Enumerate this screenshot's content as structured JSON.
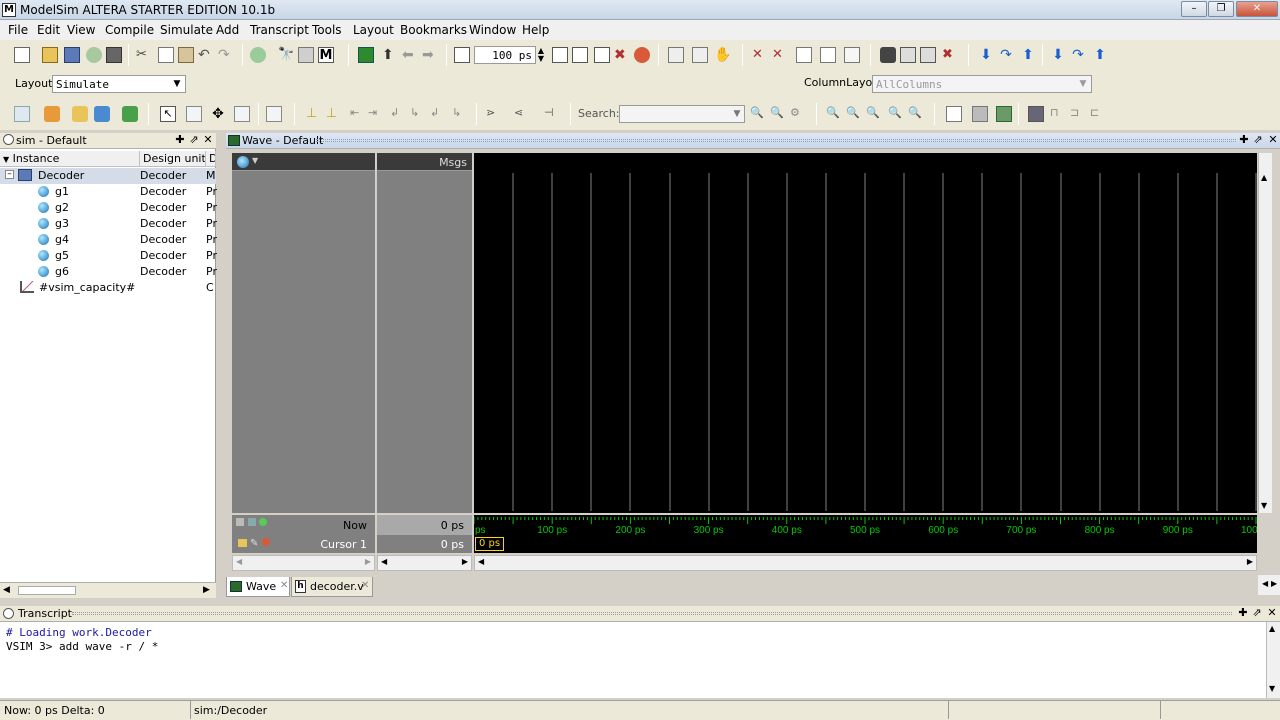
{
  "window": {
    "title": "ModelSim ALTERA STARTER EDITION 10.1b",
    "logo": "M"
  },
  "menu": [
    "File",
    "Edit",
    "View",
    "Compile",
    "Simulate",
    "Add",
    "Transcript",
    "Tools",
    "Layout",
    "Bookmarks",
    "Window",
    "Help"
  ],
  "toolbar1": {
    "run_length": "100 ps"
  },
  "layout_bar": {
    "label": "Layout",
    "value": "Simulate",
    "column_label": "ColumnLayout",
    "column_value": "AllColumns"
  },
  "toolbar3": {
    "search_label": "Search:",
    "search_value": ""
  },
  "sim_panel": {
    "title": "sim - Default",
    "columns": [
      "Instance",
      "Design unit",
      "D"
    ],
    "rows": [
      {
        "instance": "Decoder",
        "unit": "Decoder",
        "type": "M",
        "level": 0
      },
      {
        "instance": "g1",
        "unit": "Decoder",
        "type": "Pr",
        "level": 1
      },
      {
        "instance": "g2",
        "unit": "Decoder",
        "type": "Pr",
        "level": 1
      },
      {
        "instance": "g3",
        "unit": "Decoder",
        "type": "Pr",
        "level": 1
      },
      {
        "instance": "g4",
        "unit": "Decoder",
        "type": "Pr",
        "level": 1
      },
      {
        "instance": "g5",
        "unit": "Decoder",
        "type": "Pr",
        "level": 1
      },
      {
        "instance": "g6",
        "unit": "Decoder",
        "type": "Pr",
        "level": 1
      },
      {
        "instance": "#vsim_capacity#",
        "unit": "",
        "type": "C",
        "level": 0
      }
    ]
  },
  "wave_panel": {
    "title": "Wave - Default",
    "msgs_label": "Msgs",
    "now_label": "Now",
    "now_value": "0 ps",
    "cursor_label": "Cursor 1",
    "cursor_value": "0 ps",
    "cursor_marker": "0 ps",
    "timeline": [
      "ps",
      "100 ps",
      "200 ps",
      "300 ps",
      "400 ps",
      "500 ps",
      "600 ps",
      "700 ps",
      "800 ps",
      "900 ps",
      "100"
    ]
  },
  "tabs": [
    {
      "label": "Wave",
      "icon": "wave-icon"
    },
    {
      "label": "decoder.v",
      "icon": "file-h-icon"
    }
  ],
  "transcript": {
    "title": "Transcript",
    "lines": [
      "# Loading work.Decoder",
      "VSIM 3> add wave -r / *"
    ]
  },
  "status": {
    "now": "Now: 0 ps  Delta: 0",
    "context": "sim:/Decoder"
  },
  "colors": {
    "wave_bg": "#000000",
    "grid": "#7f7f7f",
    "timeline_tick": "#00cc00",
    "cursor": "#ffd400",
    "transcript_comment": "#1a1aa6"
  }
}
